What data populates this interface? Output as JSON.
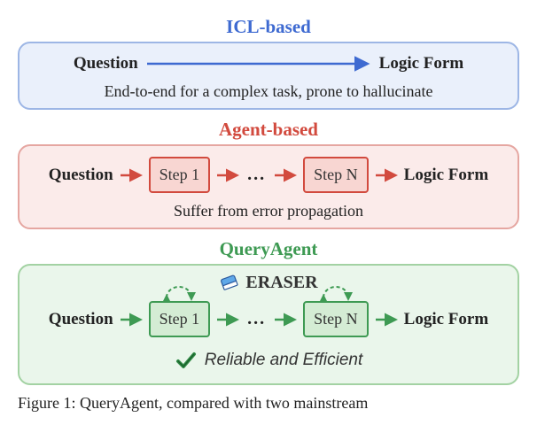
{
  "icl": {
    "title": "ICL-based",
    "question": "Question",
    "logic": "Logic Form",
    "subtext": "End-to-end for a complex task,  prone to hallucinate"
  },
  "agent": {
    "title": "Agent-based",
    "question": "Question",
    "step1": "Step 1",
    "dots": "...",
    "stepN": "Step N",
    "logic": "Logic Form",
    "subtext": "Suffer from error propagation"
  },
  "query": {
    "title": "QueryAgent",
    "eraser": "ERASER",
    "question": "Question",
    "step1": "Step 1",
    "dots": "...",
    "stepN": "Step N",
    "logic": "Logic Form",
    "reliable": "Reliable and Efficient"
  },
  "caption": "Figure 1: QueryAgent, compared with two mainstream"
}
